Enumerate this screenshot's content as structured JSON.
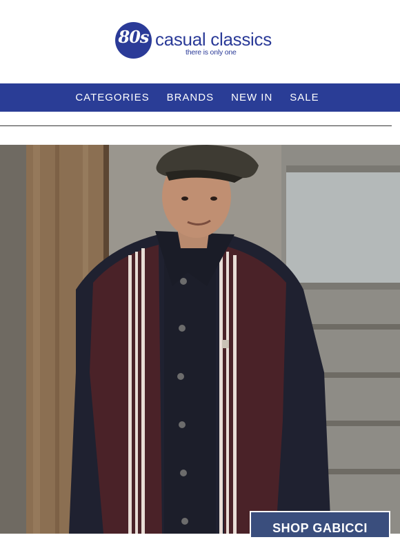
{
  "brand": {
    "logo_mark": "80s",
    "name": "casual classics",
    "tagline": "there is only one"
  },
  "nav": {
    "items": [
      {
        "label": "CATEGORIES"
      },
      {
        "label": "BRANDS"
      },
      {
        "label": "NEW IN"
      },
      {
        "label": "SALE"
      }
    ]
  },
  "hero": {
    "cta_label": "SHOP GABICCI"
  },
  "colors": {
    "brand_blue": "#2a3d96",
    "cta_background": "#3a4e7d"
  }
}
